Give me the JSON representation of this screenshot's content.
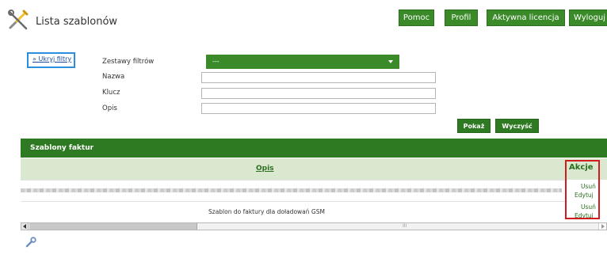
{
  "header": {
    "title": "Lista szablonów",
    "buttons": [
      "Pomoc",
      "Profil",
      "Aktywna licencja",
      "Wyloguj"
    ]
  },
  "filters": {
    "toggle_label": "» Ukryj filtry",
    "labels": {
      "filter_sets": "Zestawy filtrów",
      "name": "Nazwa",
      "key": "Klucz",
      "description": "Opis"
    },
    "filter_sets_value": "---",
    "name_value": "",
    "key_value": "",
    "description_value": "",
    "show_label": "Pokaż",
    "clear_label": "Wyczyść"
  },
  "table": {
    "title": "Szablony faktur",
    "columns": {
      "description": "Opis",
      "actions": "Akcje"
    },
    "rows": [
      {
        "description": "",
        "delete": "Usuń",
        "edit": "Edytuj"
      },
      {
        "description": "Szablon do faktury dla doładowań GSM",
        "delete": "Usuń",
        "edit": "Edytuj"
      }
    ],
    "scroll_grip": "III"
  },
  "colors": {
    "green": "#3b8a2a",
    "dark_green": "#2e7a22",
    "header_row": "#dbe8d0",
    "highlight_red": "#d01c1c",
    "highlight_blue": "#2b8fe0"
  },
  "icons": [
    "tools-icon",
    "wrench-icon"
  ]
}
